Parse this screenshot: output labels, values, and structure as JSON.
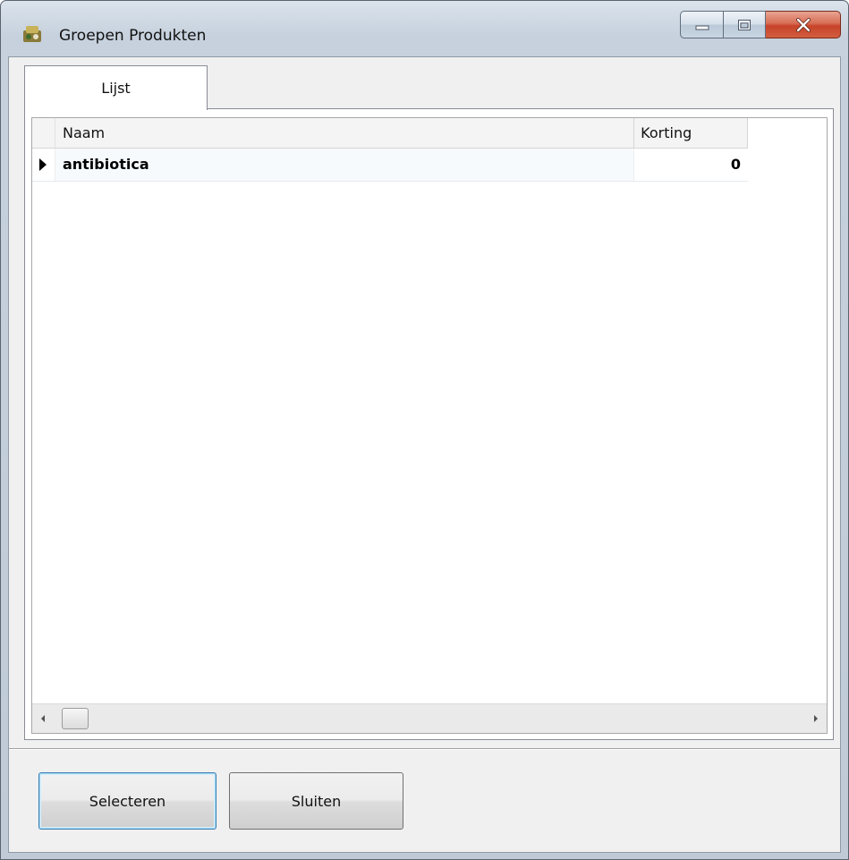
{
  "window": {
    "title": "Groepen Produkten",
    "icon": "app-icon"
  },
  "tabs": [
    {
      "label": "Lijst",
      "selected": true
    }
  ],
  "grid": {
    "columns": [
      "Naam",
      "Korting"
    ],
    "rows": [
      {
        "naam": "antibiotica",
        "korting": "0",
        "current": true
      }
    ]
  },
  "buttons": {
    "select": "Selecteren",
    "close": "Sluiten"
  },
  "colors": {
    "close_button": "#c7432a",
    "focus_border": "#3c7fb1"
  }
}
